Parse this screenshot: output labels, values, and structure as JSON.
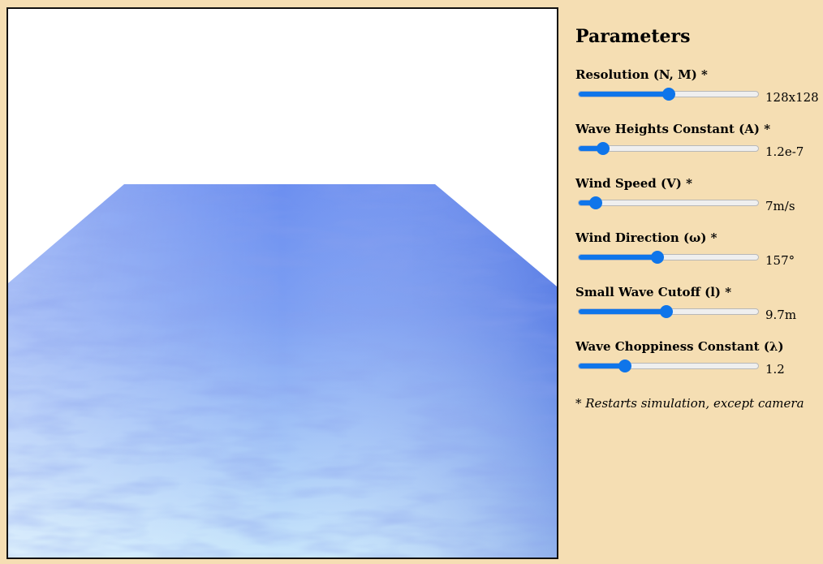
{
  "panel": {
    "title": "Parameters",
    "note": "* Restarts simulation, except camera"
  },
  "parameters": [
    {
      "label": "Resolution (N, M) *",
      "value": "128x128",
      "level": 0.5
    },
    {
      "label": "Wave Heights Constant (A) *",
      "value": "1.2e-7",
      "level": 0.14
    },
    {
      "label": "Wind Speed (V) *",
      "value": "7m/s",
      "level": 0.1
    },
    {
      "label": "Wind Direction (ω) *",
      "value": "157°",
      "level": 0.44
    },
    {
      "label": "Small Wave Cutoff (l) *",
      "value": "9.7m",
      "level": 0.49
    },
    {
      "label": "Wave Choppiness Constant (λ)",
      "value": "1.2",
      "level": 0.26
    }
  ],
  "colors": {
    "accent": "#0f75ea",
    "background": "#f5deb3",
    "water_near": "#cdeafc",
    "water_far": "#5b82e8"
  }
}
